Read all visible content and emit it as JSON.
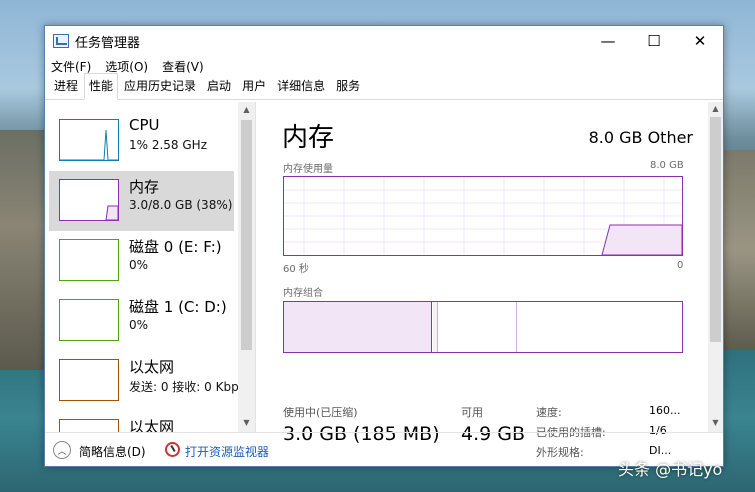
{
  "window": {
    "title": "任务管理器",
    "minimize": "—",
    "maximize": "☐",
    "close": "✕"
  },
  "menu": [
    "文件(F)",
    "选项(O)",
    "查看(V)"
  ],
  "tabs": [
    "进程",
    "性能",
    "应用历史记录",
    "启动",
    "用户",
    "详细信息",
    "服务"
  ],
  "sidebar": {
    "items": [
      {
        "name": "CPU",
        "detail": "1% 2.58 GHz",
        "color": "#117dbb"
      },
      {
        "name": "内存",
        "detail": "3.0/8.0 GB (38%)",
        "color": "#8b2fb3"
      },
      {
        "name": "磁盘 0 (E: F:)",
        "detail": "0%",
        "color": "#4da60c"
      },
      {
        "name": "磁盘 1 (C: D:)",
        "detail": "0%",
        "color": "#4da60c"
      },
      {
        "name": "以太网",
        "detail": "发送: 0 接收: 0 Kbp",
        "color": "#a74f01"
      },
      {
        "name": "以太网",
        "detail": "",
        "color": "#a74f01"
      }
    ]
  },
  "main": {
    "title": "内存",
    "capacity": "8.0 GB Other",
    "usage_label": "内存使用量",
    "usage_max": "8.0 GB",
    "time_left": "60 秒",
    "time_right": "0",
    "composition_label": "内存组合",
    "in_use_label": "使用中(已压缩)",
    "in_use_value": "3.0 GB (185 MB)",
    "available_label": "可用",
    "available_value": "4.9 GB",
    "speed_label": "速度:",
    "speed_value": "160...",
    "slots_label": "已使用的插槽:",
    "slots_value": "1/6",
    "form_label": "外形规格:",
    "form_value": "DI..."
  },
  "footer": {
    "brief": "简略信息(D)",
    "resmon": "打开资源监视器"
  },
  "watermark": "头条 @书记yo"
}
